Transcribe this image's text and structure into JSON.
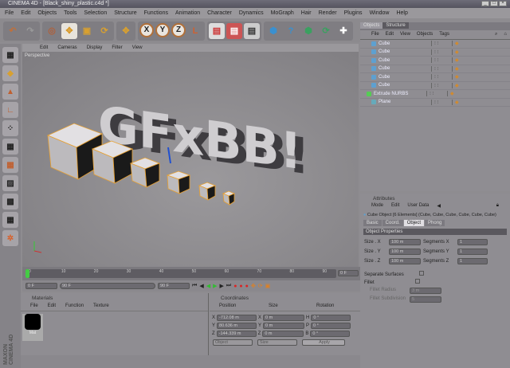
{
  "window": {
    "title": "CINEMA 4D - [Black_shiny_plastic.c4d *]",
    "controls": [
      "_",
      "□",
      "×"
    ]
  },
  "menu": [
    "File",
    "Edit",
    "Objects",
    "Tools",
    "Selection",
    "Structure",
    "Functions",
    "Animation",
    "Character",
    "Dynamics",
    "MoGraph",
    "Hair",
    "Render",
    "Plugins",
    "Window",
    "Help"
  ],
  "toolbar": {
    "axes": [
      "X",
      "Y",
      "Z"
    ]
  },
  "viewport": {
    "menu": [
      "Edit",
      "Cameras",
      "Display",
      "Filter",
      "View"
    ],
    "label": "Perspective",
    "scene_text": "GFxBB!"
  },
  "object_manager": {
    "tabs": [
      "Objects",
      "Structure"
    ],
    "menu": [
      "File",
      "Edit",
      "View",
      "Objects",
      "Tags"
    ],
    "objects": [
      "Cube",
      "Cube",
      "Cube",
      "Cube",
      "Cube",
      "Cube",
      "Extrude NURBS",
      "Plane"
    ]
  },
  "attributes": {
    "title": "Attributes",
    "menu": [
      "Mode",
      "Edit",
      "User Data"
    ],
    "object_line": "Cube Object [6 Elements] (Cube, Cube, Cube, Cube, Cube, Cube)",
    "tabs": [
      "Basic",
      "Coord.",
      "Object",
      "Phong"
    ],
    "active_tab": "Object",
    "section": "Object Properties",
    "size_rows": [
      {
        "label": "Size . X",
        "value": "100 m",
        "seg_label": "Segments X",
        "seg": "1"
      },
      {
        "label": "Size . Y",
        "value": "100 m",
        "seg_label": "Segments Y",
        "seg": "1"
      },
      {
        "label": "Size . Z",
        "value": "100 m",
        "seg_label": "Segments Z",
        "seg": "1"
      }
    ],
    "separate_surfaces": "Separate Surfaces",
    "fillet": "Fillet",
    "fillet_radius_label": "Fillet Radius",
    "fillet_radius": "3 m",
    "fillet_subdiv_label": "Fillet Subdivision",
    "fillet_subdiv": "5"
  },
  "timeline": {
    "ticks": [
      "0",
      "10",
      "20",
      "30",
      "40",
      "50",
      "60",
      "70",
      "80",
      "90"
    ],
    "current_frame": "0 F",
    "start": "0 F",
    "range": "90 F",
    "end": "90 F"
  },
  "materials": {
    "title": "Materials",
    "menu": [
      "File",
      "Edit",
      "Function",
      "Texture"
    ],
    "items": [
      "Mat"
    ]
  },
  "coordinates": {
    "title": "Coordinates",
    "headers": [
      "Position",
      "Size",
      "Rotation"
    ],
    "rows": [
      {
        "axis": "X",
        "pos": "-712.08 m",
        "size": "0 m",
        "rot_axis": "H",
        "rot": "0 °"
      },
      {
        "axis": "Y",
        "pos": "80.636 m",
        "size": "0 m",
        "rot_axis": "P",
        "rot": "0 °"
      },
      {
        "axis": "Z",
        "pos": "-144.339 m",
        "size": "0 m",
        "rot_axis": "B",
        "rot": "0 °"
      }
    ],
    "mode": "Object",
    "size_mode": "Size",
    "apply": "Apply"
  },
  "brand": "MAXON CINEMA 4D"
}
